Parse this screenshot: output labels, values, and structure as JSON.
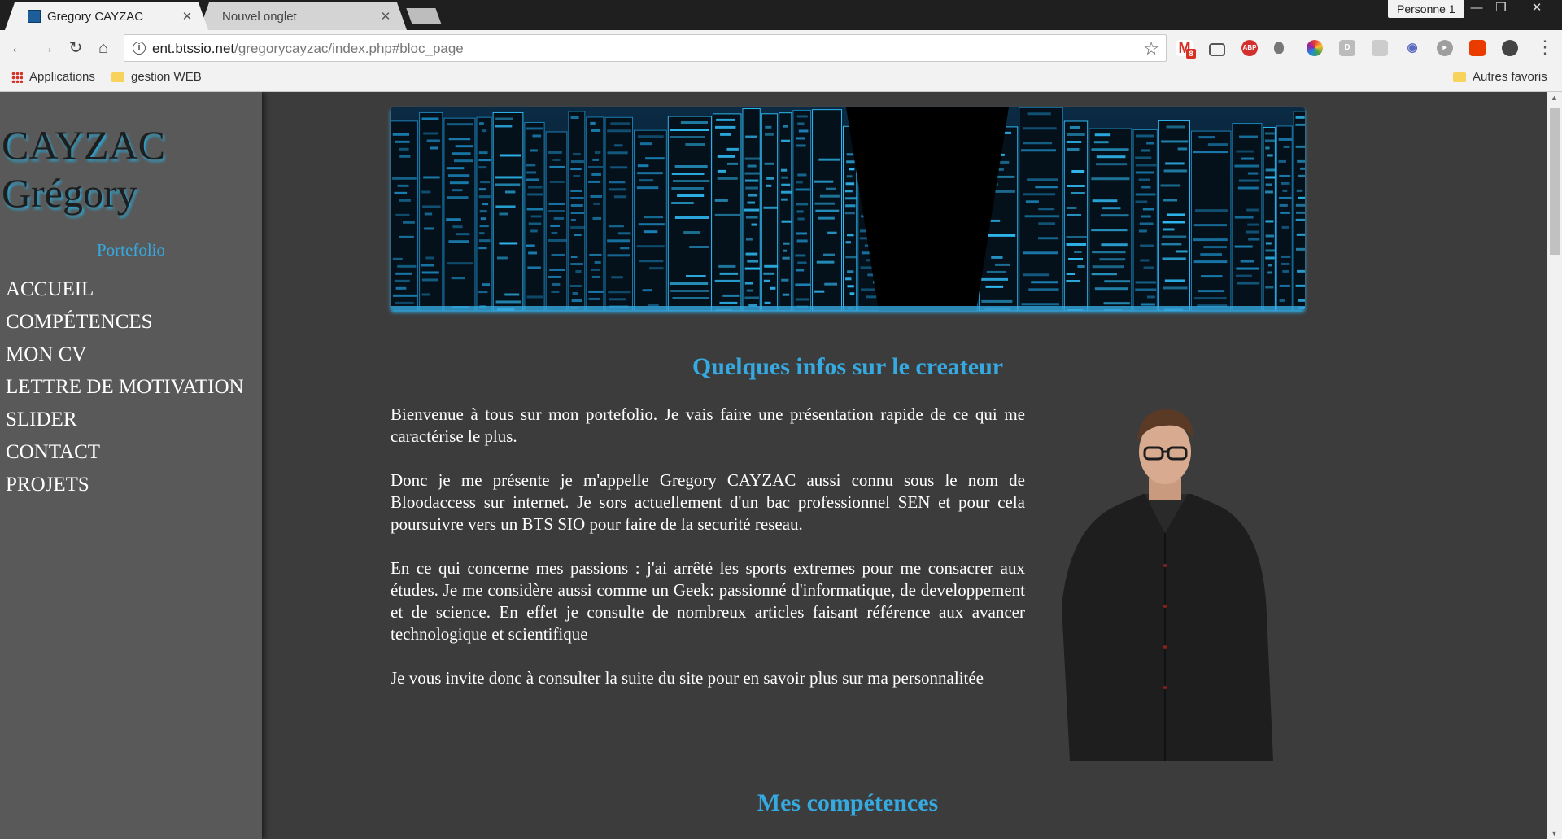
{
  "browser": {
    "tabs": [
      {
        "title": "Gregory CAYZAC",
        "active": true
      },
      {
        "title": "Nouvel onglet",
        "active": false
      }
    ],
    "profile": "Personne 1",
    "window_controls": {
      "minimize": "—",
      "restore": "❐",
      "close": "✕"
    },
    "url_host": "ent.btssio.net",
    "url_path": "/gregorycayzac/index.php#bloc_page",
    "gmail_badge": "8",
    "extensions": [
      "gmail-icon",
      "cast-icon",
      "adblock-icon",
      "bulb-icon",
      "color-wheel-icon",
      "d-extension-icon",
      "image-extension-icon",
      "owl-icon",
      "eye-icon",
      "office-icon",
      "puzzle-icon"
    ],
    "bookmarks": {
      "apps": "Applications",
      "folder1": "gestion WEB",
      "other": "Autres favoris"
    }
  },
  "site": {
    "title_line1": "CAYZAC",
    "title_line2": "Grégory",
    "subtitle": "Portefolio",
    "nav": [
      "ACCUEIL",
      "COMPÉTENCES",
      "MON CV",
      "LETTRE DE MOTIVATION",
      "SLIDER",
      "CONTACT",
      "PROJETS"
    ],
    "about_title": "Quelques infos sur le createur",
    "paragraphs": [
      "Bienvenue à tous sur mon portefolio. Je vais faire une présentation rapide de ce qui me caractérise le plus.",
      "Donc je me présente je m'appelle Gregory CAYZAC aussi connu sous le nom de Bloodaccess sur internet. Je sors actuellement d'un bac professionnel SEN et pour cela poursuivre vers un BTS SIO pour faire de la securité reseau.",
      "En ce qui concerne mes passions : j'ai arrêté les sports extremes pour me consacrer aux études. Je me considère aussi comme un Geek: passionné d'informatique, de developpement et de science. En effet je consulte de nombreux articles faisant référence aux avancer technologique et scientifique",
      "Je vous invite donc à consulter la suite du site pour en savoir plus sur ma personnalitée"
    ],
    "skills_title": "Mes compétences"
  },
  "colors": {
    "accent": "#36a9e0",
    "sidebar": "#595959",
    "page_bg": "#3c3c3c"
  }
}
